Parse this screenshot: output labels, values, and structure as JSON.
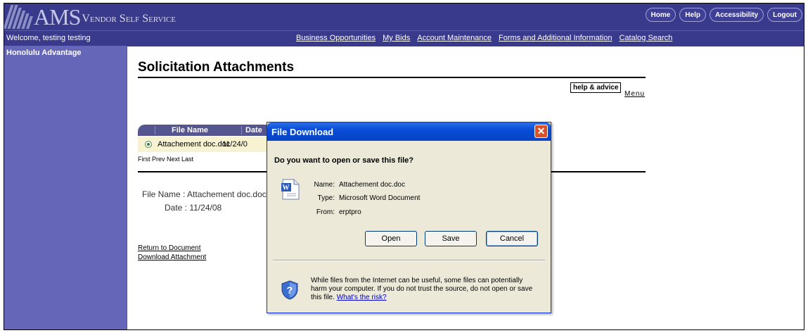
{
  "header": {
    "logo_text": "AMS",
    "logo_tagline": "Vendor Self Service",
    "buttons": [
      "Home",
      "Help",
      "Accessibility",
      "Logout"
    ]
  },
  "nav": {
    "welcome": "Welcome, testing testing",
    "links": [
      "Business Opportunities",
      "My Bids",
      "Account Maintenance",
      "Forms and Additional Information",
      "Catalog Search"
    ]
  },
  "sidebar": {
    "title": "Honolulu Advantage"
  },
  "main": {
    "title": "Solicitation Attachments",
    "help": "help & advice",
    "menu": "Menu",
    "table": {
      "columns": [
        "File Name",
        "Date"
      ],
      "rows": [
        {
          "file_name": "Attachement doc.doc",
          "date": "11/24/0"
        }
      ]
    },
    "pager": "First Prev Next Last",
    "detail": {
      "file_name_line": "File Name : Attachement doc.doc",
      "date_line": "Date : 11/24/08"
    },
    "links": {
      "return": "Return to Document",
      "download": "Download Attachment"
    }
  },
  "dialog": {
    "title": "File Download",
    "close": "✕",
    "question": "Do you want to open or save this file?",
    "name_label": "Name:",
    "name_value": "Attachement doc.doc",
    "type_label": "Type:",
    "type_value": "Microsoft Word Document",
    "from_label": "From:",
    "from_value": "erptpro",
    "buttons": {
      "open": "Open",
      "save": "Save",
      "cancel": "Cancel"
    },
    "warning": "While files from the Internet can be useful, some files can potentially harm your computer. If you do not trust the source, do not open or save this file.",
    "risk_link": "What's the risk?"
  },
  "colors": {
    "header": "#3a3a8c",
    "sidebar": "#6666b8",
    "dialog_title": "#0a4cd6",
    "row_highlight": "#f7f3d2"
  }
}
